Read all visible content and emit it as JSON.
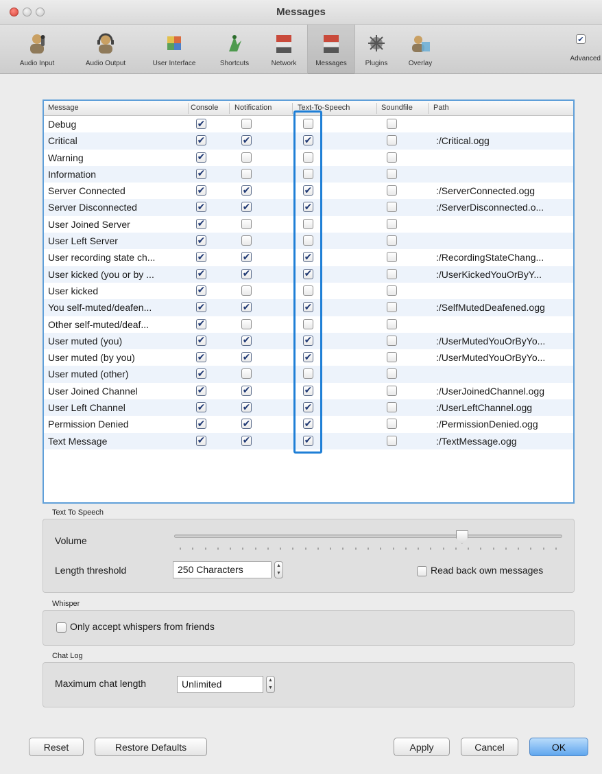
{
  "window": {
    "title": "Messages"
  },
  "toolbar": {
    "items": [
      {
        "label": "Audio Input",
        "icon": "microphone-person-icon"
      },
      {
        "label": "Audio Output",
        "icon": "headset-person-icon"
      },
      {
        "label": "User Interface",
        "icon": "user-interface-icon"
      },
      {
        "label": "Shortcuts",
        "icon": "shortcut-icon"
      },
      {
        "label": "Network",
        "icon": "network-icon"
      },
      {
        "label": "Messages",
        "icon": "messages-icon"
      },
      {
        "label": "Plugins",
        "icon": "plugins-icon"
      },
      {
        "label": "Overlay",
        "icon": "overlay-icon"
      }
    ],
    "advanced_label": "Advanced",
    "advanced_checked": true
  },
  "table": {
    "columns": [
      "Message",
      "Console",
      "Notification",
      "Text-To-Speech",
      "Soundfile",
      "Path"
    ],
    "rows": [
      {
        "message": "Debug",
        "console": true,
        "notification": false,
        "tts": false,
        "soundfile": false,
        "path": ""
      },
      {
        "message": "Critical",
        "console": true,
        "notification": true,
        "tts": true,
        "soundfile": false,
        "path": ":/Critical.ogg"
      },
      {
        "message": "Warning",
        "console": true,
        "notification": false,
        "tts": false,
        "soundfile": false,
        "path": ""
      },
      {
        "message": "Information",
        "console": true,
        "notification": false,
        "tts": false,
        "soundfile": false,
        "path": ""
      },
      {
        "message": "Server Connected",
        "console": true,
        "notification": true,
        "tts": true,
        "soundfile": false,
        "path": ":/ServerConnected.ogg"
      },
      {
        "message": "Server Disconnected",
        "console": true,
        "notification": true,
        "tts": true,
        "soundfile": false,
        "path": ":/ServerDisconnected.o..."
      },
      {
        "message": "User Joined Server",
        "console": true,
        "notification": false,
        "tts": false,
        "soundfile": false,
        "path": ""
      },
      {
        "message": "User Left Server",
        "console": true,
        "notification": false,
        "tts": false,
        "soundfile": false,
        "path": ""
      },
      {
        "message": "User recording state ch...",
        "console": true,
        "notification": true,
        "tts": true,
        "soundfile": false,
        "path": ":/RecordingStateChang..."
      },
      {
        "message": "User kicked (you or by ...",
        "console": true,
        "notification": true,
        "tts": true,
        "soundfile": false,
        "path": ":/UserKickedYouOrByY..."
      },
      {
        "message": "User kicked",
        "console": true,
        "notification": false,
        "tts": false,
        "soundfile": false,
        "path": ""
      },
      {
        "message": "You self-muted/deafen...",
        "console": true,
        "notification": true,
        "tts": true,
        "soundfile": false,
        "path": ":/SelfMutedDeafened.ogg"
      },
      {
        "message": "Other self-muted/deaf...",
        "console": true,
        "notification": false,
        "tts": false,
        "soundfile": false,
        "path": ""
      },
      {
        "message": "User muted (you)",
        "console": true,
        "notification": true,
        "tts": true,
        "soundfile": false,
        "path": ":/UserMutedYouOrByYo..."
      },
      {
        "message": "User muted (by you)",
        "console": true,
        "notification": true,
        "tts": true,
        "soundfile": false,
        "path": ":/UserMutedYouOrByYo..."
      },
      {
        "message": "User muted (other)",
        "console": true,
        "notification": false,
        "tts": false,
        "soundfile": false,
        "path": ""
      },
      {
        "message": "User Joined Channel",
        "console": true,
        "notification": true,
        "tts": true,
        "soundfile": false,
        "path": ":/UserJoinedChannel.ogg"
      },
      {
        "message": "User Left Channel",
        "console": true,
        "notification": true,
        "tts": true,
        "soundfile": false,
        "path": ":/UserLeftChannel.ogg"
      },
      {
        "message": "Permission Denied",
        "console": true,
        "notification": true,
        "tts": true,
        "soundfile": false,
        "path": ":/PermissionDenied.ogg"
      },
      {
        "message": "Text Message",
        "console": true,
        "notification": true,
        "tts": true,
        "soundfile": false,
        "path": ":/TextMessage.ogg"
      }
    ]
  },
  "tts": {
    "group_label": "Text To Speech",
    "volume_label": "Volume",
    "volume_fraction": 0.74,
    "length_label": "Length threshold",
    "length_value": "250 Characters",
    "readback_label": "Read back own messages",
    "readback_checked": false
  },
  "whisper": {
    "group_label": "Whisper",
    "friends_label": "Only accept whispers from friends",
    "friends_checked": false
  },
  "chatlog": {
    "group_label": "Chat Log",
    "max_label": "Maximum chat length",
    "max_value": "Unlimited"
  },
  "buttons": {
    "reset": "Reset",
    "restore": "Restore Defaults",
    "apply": "Apply",
    "cancel": "Cancel",
    "ok": "OK"
  },
  "colors": {
    "highlight": "#1f7fd6",
    "table_border": "#5f9fd9",
    "ok_button": "#5fa6ee"
  }
}
